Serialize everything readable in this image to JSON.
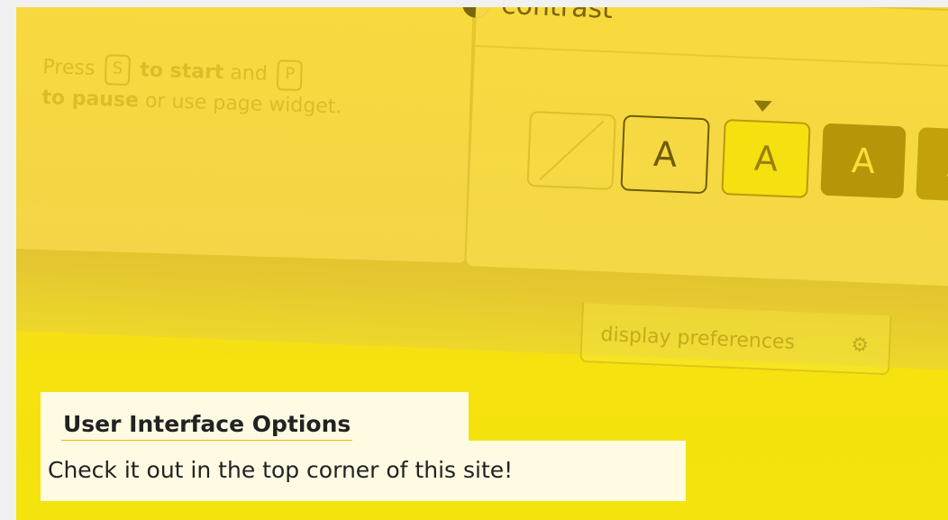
{
  "panel": {
    "press_word": "Press",
    "start_key": "S",
    "start_text": "to start",
    "and_word": "and",
    "pause_key": "P",
    "pause_text": "to pause",
    "widget_text": "or use page widget.",
    "contrast_label": "contrast",
    "swatch_letter": "A",
    "prefs_label": "display preferences",
    "prefs_icon": "gear-icon",
    "contrast_icon": "contrast-icon"
  },
  "caption": {
    "title": "User Interface Options",
    "subtitle": "Check it out in the top corner of this site!"
  },
  "colors": {
    "background": "#f4e10f",
    "caption_bg": "#fffbe3",
    "underline": "#f4b300",
    "text": "#222222"
  }
}
